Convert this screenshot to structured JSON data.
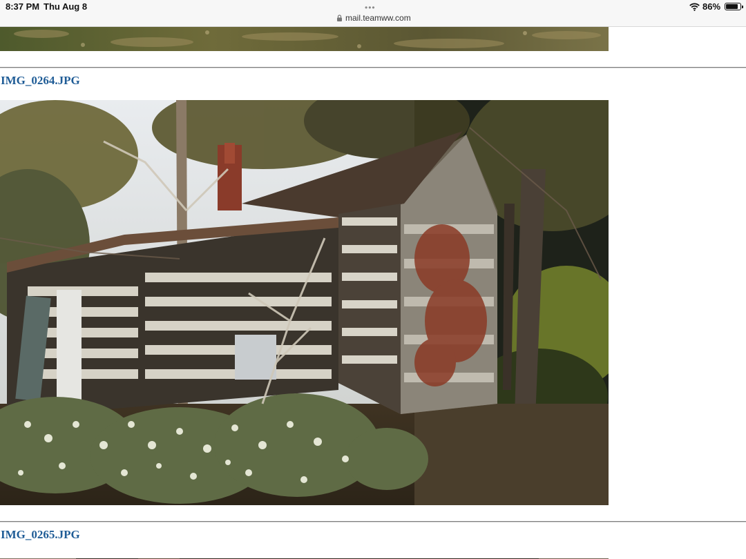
{
  "status_bar": {
    "time": "8:37 PM",
    "date": "Thu Aug 8",
    "menu_dots": "•••",
    "url": "mail.teamww.com",
    "battery_percent": "86%",
    "battery_level": 0.86,
    "icons": [
      "lock-icon",
      "wifi-icon",
      "battery-icon"
    ]
  },
  "gallery": {
    "items": [
      {
        "filename": "IMG_0264.JPG"
      },
      {
        "filename": "IMG_0265.JPG"
      }
    ]
  },
  "colors": {
    "link": "#1f5c96",
    "rule": "#7f7f7f"
  }
}
